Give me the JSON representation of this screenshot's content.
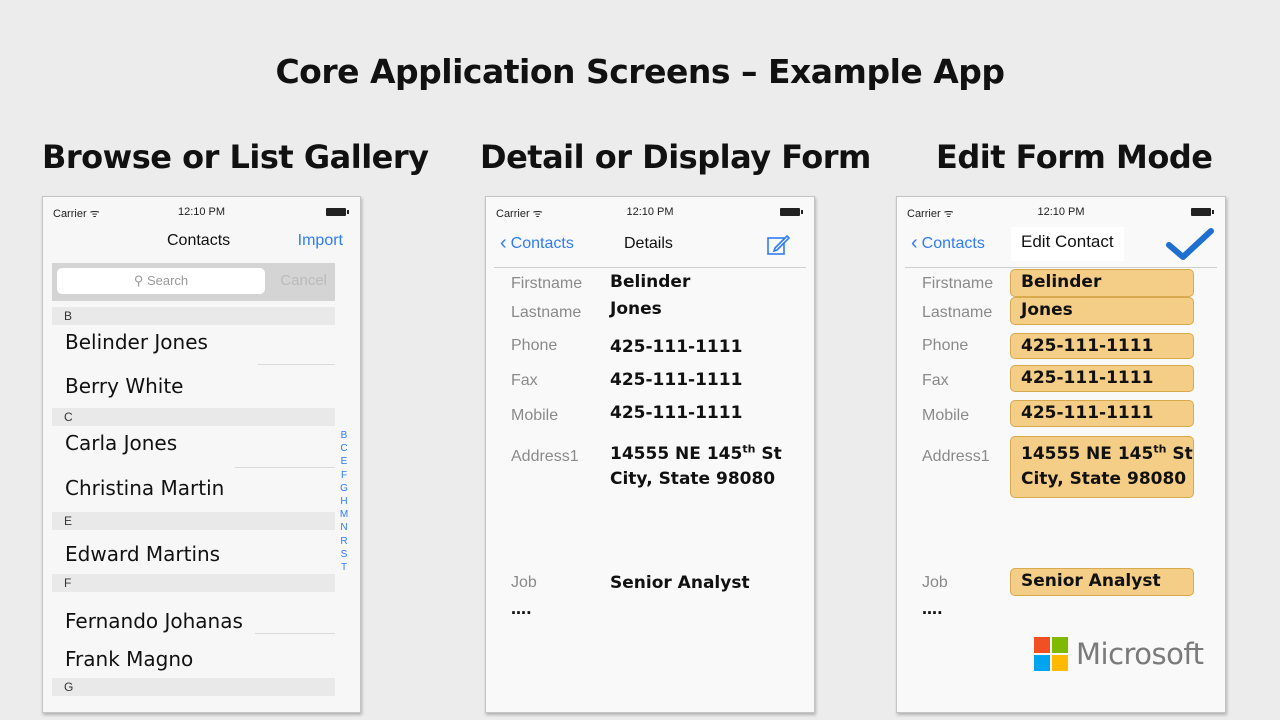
{
  "slide": {
    "title": "Core Application Screens – Example App",
    "col1_title": "Browse or List Gallery",
    "col2_title": "Detail or Display Form",
    "col3_title": "Edit Form Mode"
  },
  "status": {
    "carrier": "Carrier ᯤ",
    "time": "12:10 PM"
  },
  "list": {
    "nav_title": "Contacts",
    "import": "Import",
    "search_placeholder": "Search",
    "cancel": "Cancel",
    "sections": [
      "B",
      "C",
      "E",
      "F",
      "G"
    ],
    "contacts": [
      "Belinder Jones",
      "Berry White",
      "Carla Jones",
      "Christina Martin",
      "Edward Martins",
      "Fernando Johanas",
      "Frank Magno"
    ],
    "index_letters": [
      "B",
      "C",
      "E",
      "F",
      "G",
      "H",
      "M",
      "N",
      "R",
      "S",
      "T"
    ]
  },
  "detail": {
    "back": "Contacts",
    "title": "Details",
    "labels": {
      "firstname": "Firstname",
      "lastname": "Lastname",
      "phone": "Phone",
      "fax": "Fax",
      "mobile": "Mobile",
      "address": "Address1",
      "job": "Job",
      "more": "…."
    },
    "values": {
      "firstname": "Belinder",
      "lastname": "Jones",
      "phone": "425-111-1111",
      "fax": "425-111-1111",
      "mobile": "425-111-1111",
      "address_line1_pre": "14555 NE 145",
      "address_sup": "th",
      "address_line1_post": " St",
      "address_line2": "City, State 98080",
      "job": "Senior Analyst"
    }
  },
  "edit": {
    "back": "Contacts",
    "title": "Edit Contact"
  },
  "brand": {
    "name": "Microsoft",
    "colors": [
      "#f25022",
      "#7fba00",
      "#00a4ef",
      "#ffb900"
    ]
  },
  "colors": {
    "ios_blue": "#2f7cf6",
    "field_fill": "#f4cd86"
  }
}
